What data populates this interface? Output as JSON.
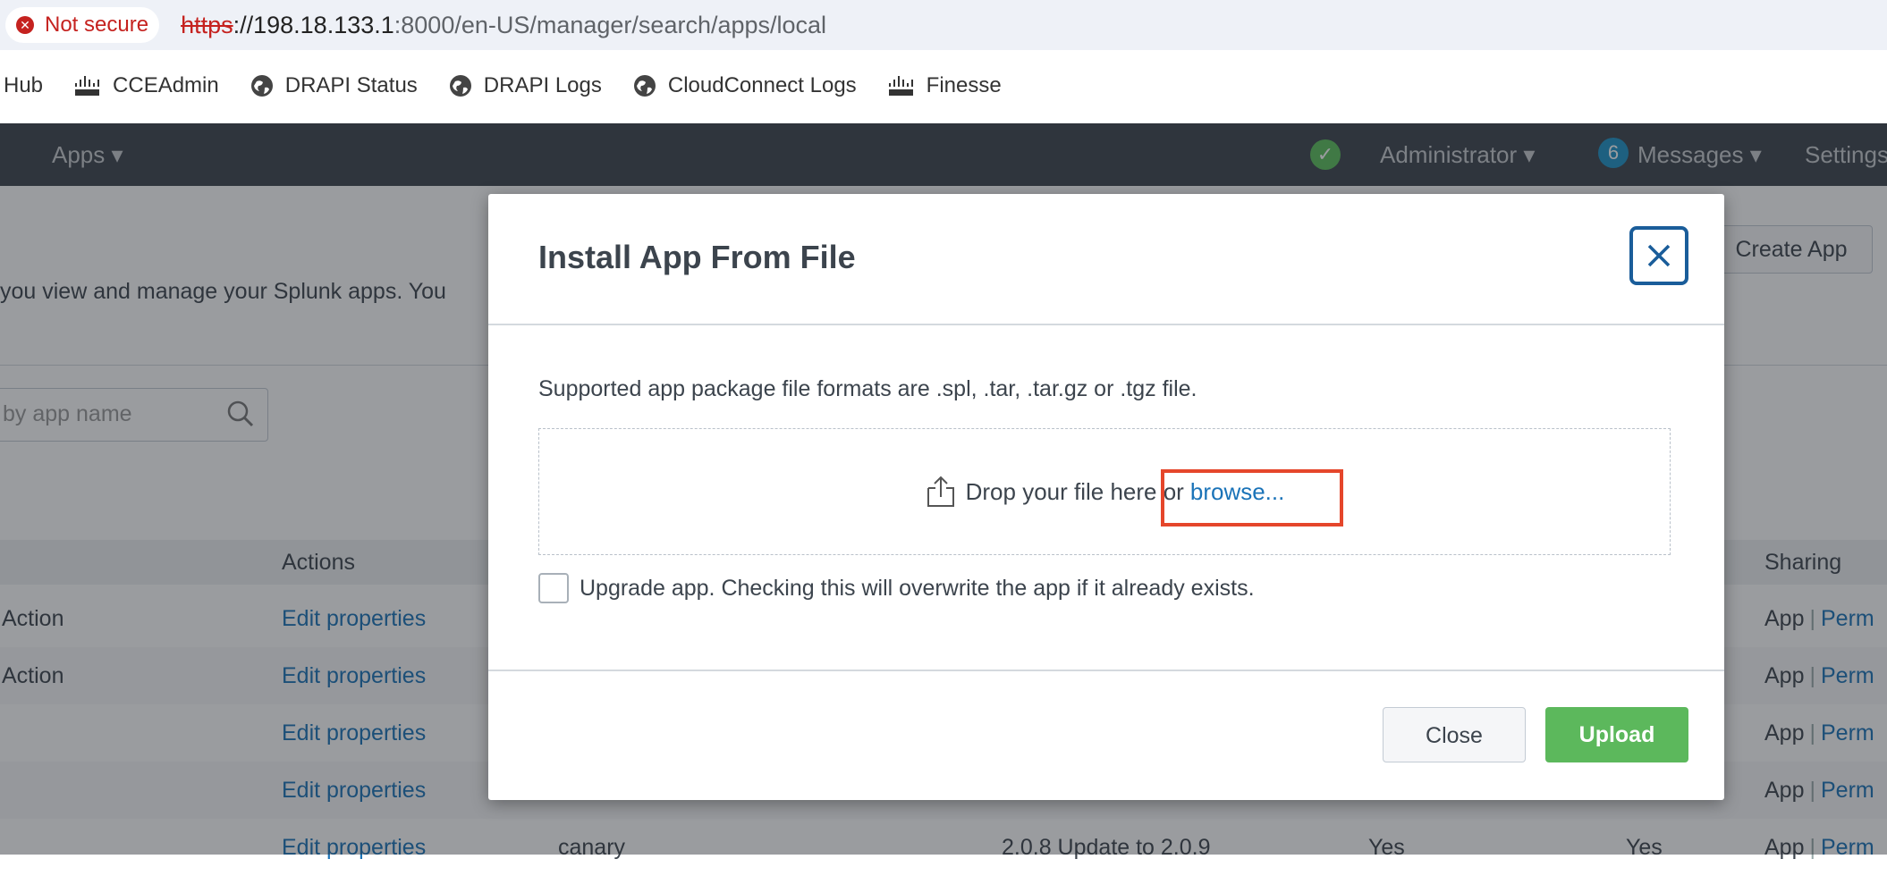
{
  "browser": {
    "security_label": "Not secure",
    "url_scheme": "https",
    "url_rest_host": "://198.18.133.1",
    "url_rest_path": ":8000/en-US/manager/search/apps/local",
    "bookmarks": [
      {
        "label": "Hub",
        "icon": "none"
      },
      {
        "label": "CCEAdmin",
        "icon": "cisco-logo-icon"
      },
      {
        "label": "DRAPI Status",
        "icon": "globe-icon"
      },
      {
        "label": "DRAPI Logs",
        "icon": "globe-icon"
      },
      {
        "label": "CloudConnect Logs",
        "icon": "globe-icon"
      },
      {
        "label": "Finesse",
        "icon": "cisco-logo-icon"
      }
    ]
  },
  "splunk_nav": {
    "apps": "Apps ▾",
    "status_icon": "check-circle-icon",
    "admin": "Administrator ▾",
    "messages_count": "6",
    "messages": "Messages ▾",
    "settings": "Settings"
  },
  "page": {
    "create_app": "Create App",
    "description": "you view and manage your Splunk apps. You",
    "search_placeholder": "by app name",
    "columns": {
      "actions": "Actions",
      "sharing": "Sharing"
    },
    "rows": [
      {
        "c0": "Action",
        "c1": "Edit properties",
        "c2": "",
        "c3": "",
        "c4": "",
        "c5": "",
        "sharing_app": "App",
        "sharing_perm": "Perm"
      },
      {
        "c0": "Action",
        "c1": "Edit properties",
        "c2": "",
        "c3": "",
        "c4": "",
        "c5": "",
        "sharing_app": "App",
        "sharing_perm": "Perm"
      },
      {
        "c0": "",
        "c1": "Edit properties",
        "c2": "",
        "c3": "",
        "c4": "",
        "c5": "",
        "sharing_app": "App",
        "sharing_perm": "Perm"
      },
      {
        "c0": "",
        "c1": "Edit properties",
        "c2": "",
        "c3": "",
        "c4": "",
        "c5": "",
        "sharing_app": "App",
        "sharing_perm": "Perm"
      },
      {
        "c0": "",
        "c1": "Edit properties",
        "c2": "canary",
        "c3": "2.0.8 Update to 2.0.9",
        "c4": "Yes",
        "c5": "Yes",
        "sharing_app": "App",
        "sharing_perm": "Perm"
      }
    ]
  },
  "modal": {
    "title": "Install App From File",
    "close_icon": "close-icon",
    "formats_text": "Supported app package file formats are .spl, .tar, .tar.gz or .tgz file.",
    "drop_text": "Drop your file here or",
    "browse_text": "browse...",
    "upgrade_checked": false,
    "upgrade_text": "Upgrade app. Checking this will overwrite the app if it already exists.",
    "close_label": "Close",
    "upload_label": "Upload",
    "highlight_color": "#e5462b",
    "upload_color": "#5cb85c"
  }
}
